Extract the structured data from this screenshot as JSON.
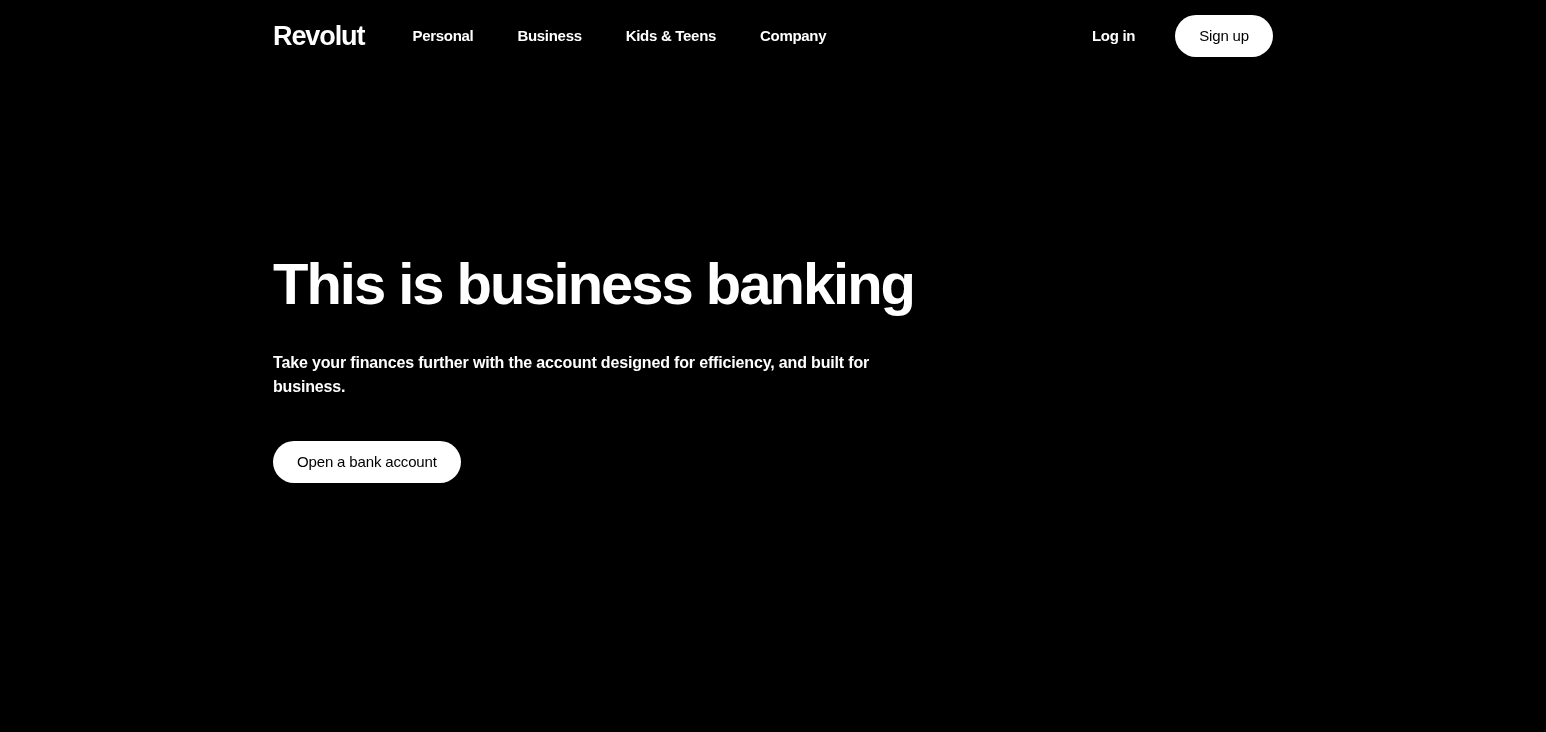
{
  "header": {
    "logo": "Revolut",
    "nav": [
      "Personal",
      "Business",
      "Kids & Teens",
      "Company"
    ],
    "login": "Log in",
    "signup": "Sign up"
  },
  "hero": {
    "title": "This is business banking",
    "subtitle": "Take your finances further with the account designed for efficiency, and built for business.",
    "cta": "Open a bank account"
  }
}
